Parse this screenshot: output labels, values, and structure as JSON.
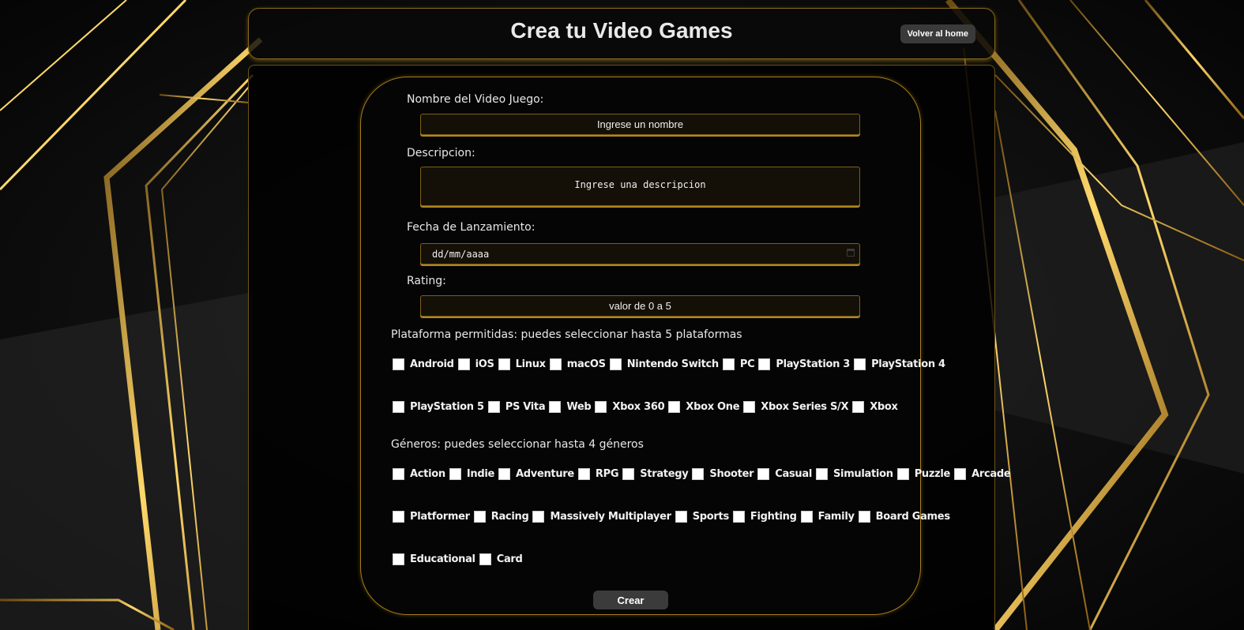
{
  "header": {
    "title": "Crea tu Video Games",
    "home_button": "Volver al home"
  },
  "form": {
    "name_label": "Nombre del Video Juego:",
    "name_placeholder": "Ingrese un nombre",
    "description_label": "Descripcion:",
    "description_placeholder": "Ingrese una descripcion",
    "release_label": "Fecha de Lanzamiento:",
    "release_placeholder": "dd/mm/aaaa",
    "rating_label": "Rating:",
    "rating_placeholder": "valor de 0 a 5",
    "platforms_label": "Plataforma permitidas: puedes seleccionar hasta 5 plataformas",
    "platforms": [
      [
        "Android",
        "iOS",
        "Linux",
        "macOS",
        "Nintendo Switch",
        "PC",
        "PlayStation 3",
        "PlayStation 4"
      ],
      [
        "PlayStation 5",
        "PS Vita",
        "Web",
        "Xbox 360",
        "Xbox One",
        "Xbox Series S/X",
        "Xbox"
      ]
    ],
    "genres_label": "Géneros: puedes seleccionar hasta 4 géneros",
    "genres": [
      [
        "Action",
        "Indie",
        "Adventure",
        "RPG",
        "Strategy",
        "Shooter",
        "Casual",
        "Simulation",
        "Puzzle",
        "Arcade"
      ],
      [
        "Platformer",
        "Racing",
        "Massively Multiplayer",
        "Sports",
        "Fighting",
        "Family",
        "Board Games"
      ],
      [
        "Educational",
        "Card"
      ]
    ],
    "submit_label": "Crear"
  },
  "colors": {
    "accent_gold": "#d4a017",
    "background": "#0b0b0b",
    "button_gray": "#3b3b3b"
  }
}
